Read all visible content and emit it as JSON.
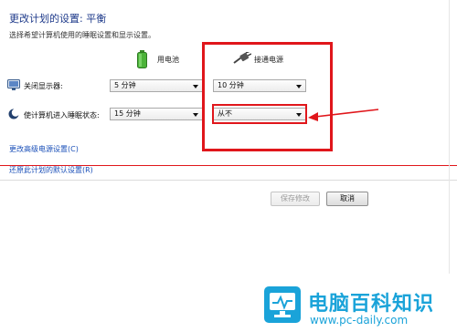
{
  "page": {
    "title": "更改计划的设置: 平衡",
    "subtitle": "选择希望计算机使用的睡眠设置和显示设置。"
  },
  "columns": {
    "battery": "用电池",
    "plugged_in": "接通电源"
  },
  "rows": [
    {
      "label": "关闭显示器:",
      "battery_value": "5 分钟",
      "plugged_value": "10 分钟"
    },
    {
      "label": "使计算机进入睡眠状态:",
      "battery_value": "15 分钟",
      "plugged_value": "从不"
    }
  ],
  "links": {
    "advanced": "更改高级电源设置(C)",
    "restore": "还原此计划的默认设置(R)"
  },
  "buttons": {
    "save": "保存修改",
    "cancel": "取消"
  },
  "watermark": {
    "name": "电脑百科知识",
    "url": "www.pc-daily.com"
  },
  "colors": {
    "annotation_red": "#e0161b",
    "title_blue": "#1e3a8a",
    "link_blue": "#1a4fb8",
    "watermark_blue": "#1aa3d9"
  }
}
